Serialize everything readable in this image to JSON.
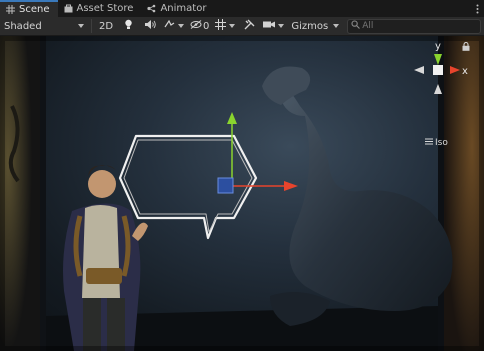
{
  "tabs": [
    {
      "label": "Scene",
      "icon": "grid-icon",
      "active": true
    },
    {
      "label": "Asset Store",
      "icon": "asset-store-icon",
      "active": false
    },
    {
      "label": "Animator",
      "icon": "animator-icon",
      "active": false
    }
  ],
  "toolbar": {
    "shading_mode": "Shaded",
    "mode_2d": "2D",
    "hidden_count": "0",
    "gizmos_label": "Gizmos",
    "search_placeholder": "All"
  },
  "gizmo": {
    "y_label": "y",
    "x_label": "x",
    "projection_label": "Iso"
  },
  "colors": {
    "x_axis": "#e8442c",
    "y_axis": "#8ad42e",
    "z_axis": "#3a6bd8",
    "active_tab_accent": "#3a79bb"
  }
}
